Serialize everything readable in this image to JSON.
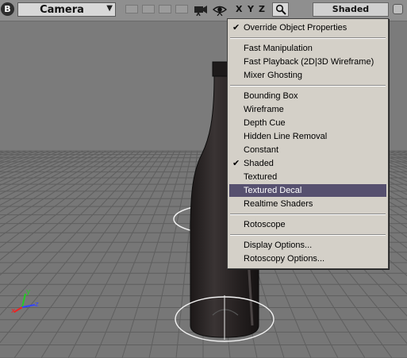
{
  "toolbar": {
    "badge": "B",
    "camera_label": "Camera",
    "camera_arrow": "▼",
    "axis_x": "X",
    "axis_y": "Y",
    "axis_z": "Z",
    "shading_label": "Shaded",
    "icons": [
      "film-camera-icon",
      "eye-icon",
      "magnifier-icon"
    ]
  },
  "menu": {
    "items": [
      {
        "label": "Override Object Properties",
        "checked": true
      },
      {
        "label": "Fast Manipulation"
      },
      {
        "label": "Fast Playback (2D|3D Wireframe)"
      },
      {
        "label": "Mixer Ghosting"
      },
      {
        "label": "Bounding Box"
      },
      {
        "label": "Wireframe"
      },
      {
        "label": "Depth Cue"
      },
      {
        "label": "Hidden Line Removal"
      },
      {
        "label": "Constant"
      },
      {
        "label": "Shaded",
        "checked": true
      },
      {
        "label": "Textured"
      },
      {
        "label": "Textured Decal",
        "highlighted": true
      },
      {
        "label": "Realtime Shaders"
      },
      {
        "label": "Rotoscope"
      },
      {
        "label": "Display Options..."
      },
      {
        "label": "Rotoscopy Options..."
      }
    ],
    "highlight_color": "#56506f"
  },
  "scene": {
    "axis_labels": {
      "x": "x",
      "y": "y",
      "z": "z"
    },
    "colors": {
      "background": "#7b7b7b",
      "grid": "#5f5f5f",
      "bottle": "#262222",
      "axis_x": "#ee2222",
      "axis_y": "#22cc22",
      "axis_z": "#3344ff"
    }
  }
}
